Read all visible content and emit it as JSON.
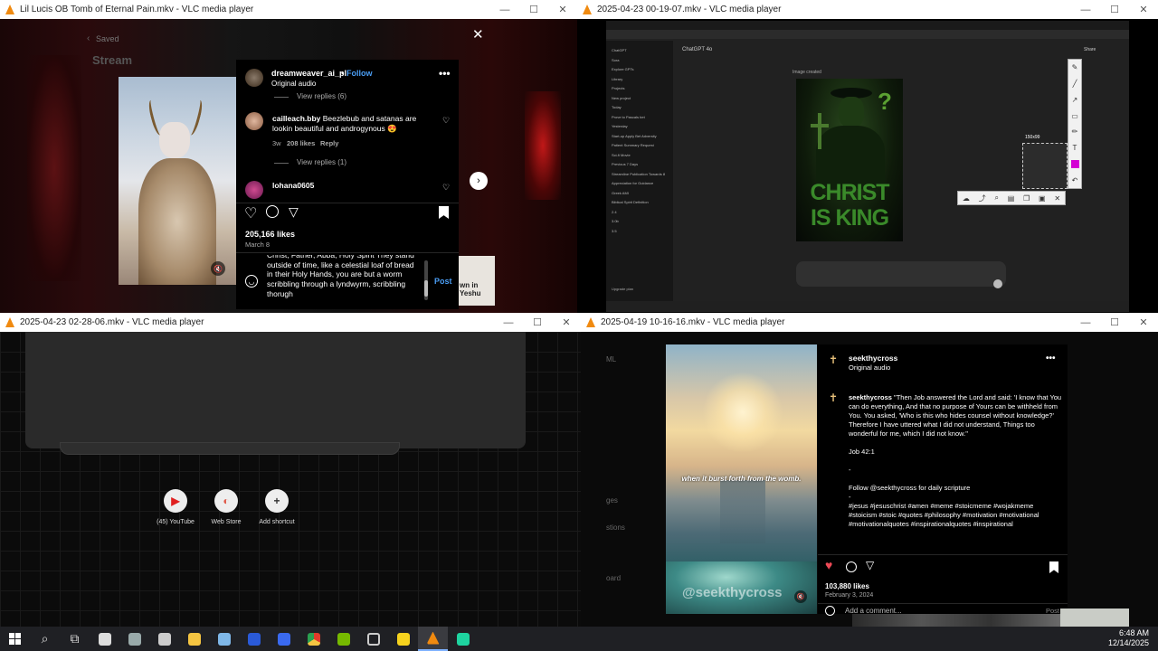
{
  "windows": {
    "w1": {
      "title": "Lil Lucis OB Tomb of Eternal Pain.mkv - VLC media player"
    },
    "w2": {
      "title": "2025-04-23 00-19-07.mkv - VLC media player"
    },
    "w3": {
      "title": "2025-04-23 02-28-06.mkv - VLC media player"
    },
    "w4": {
      "title": "2025-04-19 10-16-16.mkv - VLC media player"
    }
  },
  "w1": {
    "saved": "Saved",
    "stream": "Stream",
    "close": "✕",
    "author": "dreamweaver_ai_pl",
    "follow": "Follow",
    "audio": "Original audio",
    "view_replies_6": "View replies (6)",
    "comment1_user": "cailleach.bby",
    "comment1_text": "Beezlebub and satanas are lookin beautiful and androgynous 😍",
    "comment1_meta": "3w",
    "comment1_likes": "208 likes",
    "comment1_reply": "Reply",
    "view_replies_1": "View replies (1)",
    "comment2_user": "lohana0605",
    "likes": "205,166 likes",
    "date": "March 8",
    "draft": "Christ, Father, Abba, Holy Spirit They stand outside of time, like a celestial loaf of bread in their Holy Hands, you are but a worm scribbling through a lyndwyrm, scribbling thorugh",
    "post": "Post",
    "bg_text": "wn in Yeshu"
  },
  "w2": {
    "app": "ChatGPT 4o",
    "image_label": "Image created",
    "poster_line1": "CHRIST",
    "poster_line2": "IS KING",
    "selection_size": "150x99",
    "share": "Share",
    "sidebar": [
      "ChatGPT",
      "Sora",
      "Explore GPTs",
      "Library",
      "Projects",
      "New project",
      "Today",
      "Prove to Pascals bet",
      "Yesterday",
      "Start-up Apply Bet Adversity",
      "Patient Summary Request",
      "Sci-fi Movie",
      "Previous 7 Days",
      "Streamline Publication Towards 8",
      "Appreciation for Guidance",
      "Greek AMI",
      "Biblical Spirit Definition",
      "2.4",
      "3.0b",
      "3.5"
    ],
    "bottom_label": "Upgrade plan"
  },
  "w3": {
    "shortcuts": [
      {
        "label": "(45) YouTube",
        "icon": "▶",
        "color": "#e02020"
      },
      {
        "label": "Web Store",
        "icon": "◐",
        "color": "#e05a4a"
      },
      {
        "label": "Add shortcut",
        "icon": "+",
        "color": "#333"
      }
    ]
  },
  "w4": {
    "author": "seekthycross",
    "audio": "Original audio",
    "caption_user": "seekthycross",
    "caption": "\"Then Job answered the Lord and said: 'I know that You can do everything, And that no purpose of Yours can be withheld from You. You asked, 'Who is this who hides counsel without knowledge?' Therefore I have uttered what I did not understand, Things too wonderful for me, which I did not know.\"",
    "verse": "Job 42:1",
    "dash": "-",
    "follow_line": "Follow @seekthycross for daily scripture",
    "dot": "-",
    "tags": "#jesus #jesuschrist #amen #meme #stoicmeme #wojakmeme #stoicism #stoic #quotes #philosophy #motivation #motivational #motivationalquotes #inspirationalquotes #inspirational",
    "overlay_text": "when it burst forth from the womb.",
    "watermark": "@seekthycross",
    "likes": "103,880 likes",
    "date": "February 3, 2024",
    "comment_placeholder": "Add a comment...",
    "post": "Post",
    "side_labels": [
      "ML",
      "ges",
      "stions",
      "oard"
    ]
  },
  "taskbar": {
    "time": "6:48 AM",
    "date": "12/14/2025"
  },
  "colors": {
    "ig_blue": "#4b9ef5",
    "heart_red": "#ed4956",
    "poster_green": "#3a8a2a",
    "vlc_orange": "#f08a10"
  }
}
